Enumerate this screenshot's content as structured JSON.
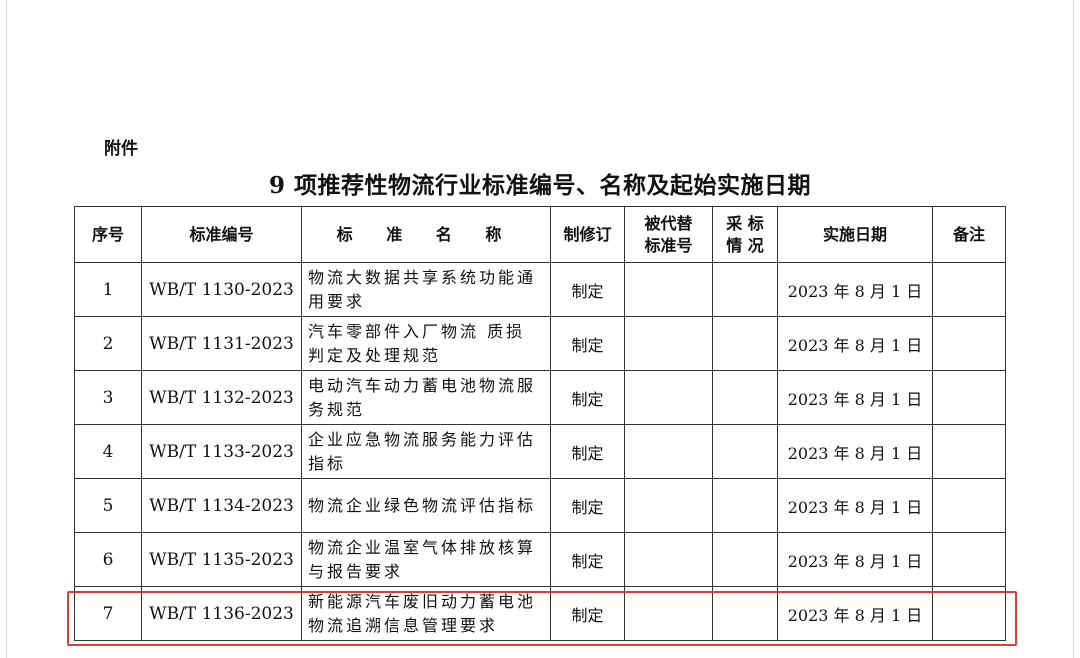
{
  "attachment_label": "附件",
  "title": "9 项推荐性物流行业标准编号、名称及起始实施日期",
  "table": {
    "headers": {
      "seq": "序号",
      "code": "标准编号",
      "name": "标 准 名 称",
      "revision": "制修订",
      "replaced_line1": "被代替",
      "replaced_line2": "标准号",
      "adopt_line1": "采 标",
      "adopt_line2": "情 况",
      "date": "实施日期",
      "remark": "备注"
    },
    "rows": [
      {
        "seq": "1",
        "code": "WB/T 1130-2023",
        "name_line1": "物流大数据共享系统功能通",
        "name_line2": "用要求",
        "revision": "制定",
        "replaced": "",
        "adopt": "",
        "date": "2023 年 8 月 1 日",
        "remark": ""
      },
      {
        "seq": "2",
        "code": "WB/T 1131-2023",
        "name_line1": "汽车零部件入厂物流 质损",
        "name_line2": "判定及处理规范",
        "revision": "制定",
        "replaced": "",
        "adopt": "",
        "date": "2023 年 8 月 1 日",
        "remark": ""
      },
      {
        "seq": "3",
        "code": "WB/T 1132-2023",
        "name_line1": "电动汽车动力蓄电池物流服",
        "name_line2": "务规范",
        "revision": "制定",
        "replaced": "",
        "adopt": "",
        "date": "2023 年 8 月 1 日",
        "remark": ""
      },
      {
        "seq": "4",
        "code": "WB/T 1133-2023",
        "name_line1": "企业应急物流服务能力评估",
        "name_line2": "指标",
        "revision": "制定",
        "replaced": "",
        "adopt": "",
        "date": "2023 年 8 月 1 日",
        "remark": ""
      },
      {
        "seq": "5",
        "code": "WB/T 1134-2023",
        "name_line1": "物流企业绿色物流评估指标",
        "name_line2": "",
        "revision": "制定",
        "replaced": "",
        "adopt": "",
        "date": "2023 年 8 月 1 日",
        "remark": ""
      },
      {
        "seq": "6",
        "code": "WB/T 1135-2023",
        "name_line1": "物流企业温室气体排放核算",
        "name_line2": "与报告要求",
        "revision": "制定",
        "replaced": "",
        "adopt": "",
        "date": "2023 年 8 月 1 日",
        "remark": ""
      },
      {
        "seq": "7",
        "code": "WB/T 1136-2023",
        "name_line1": "新能源汽车废旧动力蓄电池",
        "name_line2": "物流追溯信息管理要求",
        "revision": "制定",
        "replaced": "",
        "adopt": "",
        "date": "2023 年 8 月 1 日",
        "remark": ""
      }
    ]
  },
  "colors": {
    "highlight": "#e03a3a"
  }
}
